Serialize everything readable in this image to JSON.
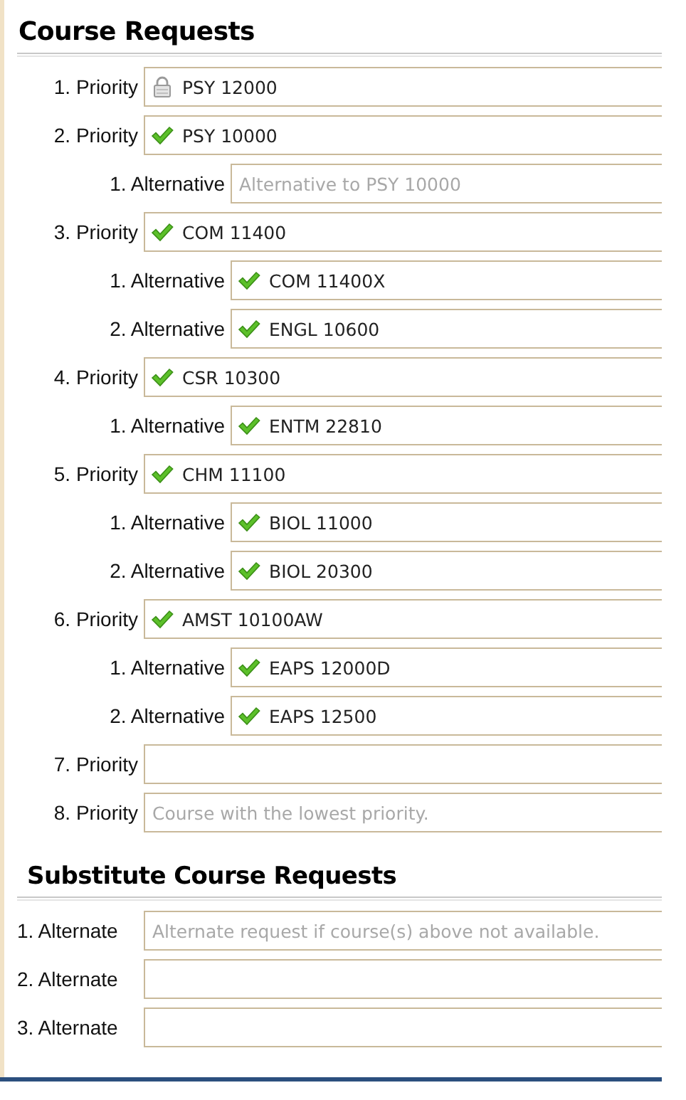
{
  "sections": [
    {
      "title": "Course Requests",
      "rows": [
        {
          "kind": "priority",
          "label": "1. Priority",
          "locked": true,
          "approved": false,
          "value": "PSY 12000"
        },
        {
          "kind": "priority",
          "label": "2. Priority",
          "locked": false,
          "approved": true,
          "value": "PSY 10000"
        },
        {
          "kind": "alternative",
          "label": "1. Alternative",
          "locked": false,
          "approved": false,
          "placeholder": "Alternative to PSY 10000"
        },
        {
          "kind": "priority",
          "label": "3. Priority",
          "locked": false,
          "approved": true,
          "value": "COM 11400"
        },
        {
          "kind": "alternative",
          "label": "1. Alternative",
          "locked": false,
          "approved": true,
          "value": "COM 11400X"
        },
        {
          "kind": "alternative",
          "label": "2. Alternative",
          "locked": false,
          "approved": true,
          "value": "ENGL 10600"
        },
        {
          "kind": "priority",
          "label": "4. Priority",
          "locked": false,
          "approved": true,
          "value": "CSR 10300"
        },
        {
          "kind": "alternative",
          "label": "1. Alternative",
          "locked": false,
          "approved": true,
          "value": "ENTM 22810"
        },
        {
          "kind": "priority",
          "label": "5. Priority",
          "locked": false,
          "approved": true,
          "value": "CHM 11100"
        },
        {
          "kind": "alternative",
          "label": "1. Alternative",
          "locked": false,
          "approved": true,
          "value": "BIOL 11000"
        },
        {
          "kind": "alternative",
          "label": "2. Alternative",
          "locked": false,
          "approved": true,
          "value": "BIOL 20300"
        },
        {
          "kind": "priority",
          "label": "6. Priority",
          "locked": false,
          "approved": true,
          "value": "AMST 10100AW"
        },
        {
          "kind": "alternative",
          "label": "1. Alternative",
          "locked": false,
          "approved": true,
          "value": "EAPS 12000D"
        },
        {
          "kind": "alternative",
          "label": "2. Alternative",
          "locked": false,
          "approved": true,
          "value": "EAPS 12500"
        },
        {
          "kind": "priority",
          "label": "7. Priority",
          "locked": false,
          "approved": false
        },
        {
          "kind": "priority",
          "label": "8. Priority",
          "locked": false,
          "approved": false,
          "placeholder": "Course with the lowest priority."
        }
      ]
    },
    {
      "title": "Substitute Course Requests",
      "rows": [
        {
          "kind": "alternate",
          "label": "1. Alternate",
          "locked": false,
          "approved": false,
          "placeholder": "Alternate request if course(s) above not available."
        },
        {
          "kind": "alternate",
          "label": "2. Alternate",
          "locked": false,
          "approved": false
        },
        {
          "kind": "alternate",
          "label": "3. Alternate",
          "locked": false,
          "approved": false
        }
      ]
    }
  ]
}
